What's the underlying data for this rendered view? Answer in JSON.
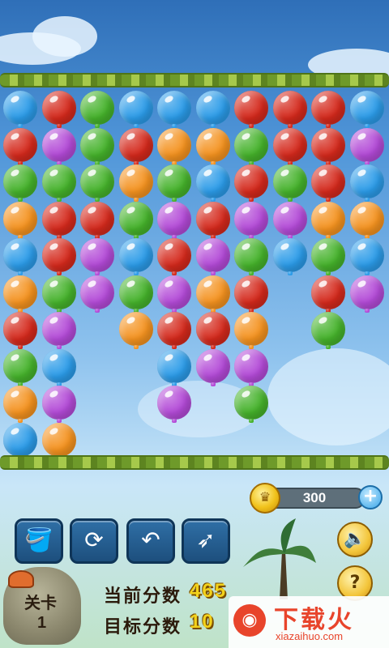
{
  "colors": {
    "blue": "#2b9be8",
    "red": "#d4291c",
    "green": "#45b22b",
    "orange": "#f4921f",
    "purple": "#b34ad7"
  },
  "board": {
    "rows": [
      [
        "blue",
        "red",
        "green",
        "blue",
        "blue",
        "blue",
        "red",
        "red",
        "red",
        "blue"
      ],
      [
        "red",
        "purple",
        "green",
        "red",
        "orange",
        "orange",
        "green",
        "red",
        "red",
        "purple"
      ],
      [
        "green",
        "green",
        "green",
        "orange",
        "green",
        "blue",
        "red",
        "green",
        "red",
        "blue"
      ],
      [
        "orange",
        "red",
        "red",
        "green",
        "purple",
        "red",
        "purple",
        "purple",
        "orange",
        "orange"
      ],
      [
        "blue",
        "red",
        "purple",
        "blue",
        "red",
        "purple",
        "green",
        "blue",
        "green",
        "blue"
      ],
      [
        "orange",
        "green",
        "purple",
        "green",
        "purple",
        "orange",
        "red",
        null,
        "red",
        "purple"
      ],
      [
        "red",
        "purple",
        null,
        "orange",
        "red",
        "red",
        "orange",
        null,
        "green",
        null
      ],
      [
        "green",
        "blue",
        null,
        null,
        "blue",
        "purple",
        "purple",
        null,
        null,
        null
      ],
      [
        "orange",
        "purple",
        null,
        null,
        "purple",
        null,
        "green",
        null,
        null,
        null
      ],
      [
        "blue",
        "orange",
        null,
        null,
        null,
        null,
        null,
        null,
        null,
        null
      ]
    ]
  },
  "hud": {
    "coins": "300",
    "plus_icon": "+",
    "score_label": "当前分数",
    "score_value": "465",
    "target_label": "目标分数",
    "target_value": "10",
    "level_label": "关卡",
    "level_value": "1"
  },
  "tools": [
    {
      "name": "paint-bucket-tool",
      "icon": "paint-bucket-icon",
      "glyph": "🪣"
    },
    {
      "name": "refresh-tool",
      "icon": "refresh-icon",
      "glyph": "⟳"
    },
    {
      "name": "undo-tool",
      "icon": "undo-icon",
      "glyph": "↶"
    },
    {
      "name": "dart-tool",
      "icon": "dart-icon",
      "glyph": "➶"
    }
  ],
  "buttons": {
    "sound_glyph": "🔈",
    "help_glyph": "?"
  },
  "watermark": {
    "logo_glyph": "◉",
    "title": "下载火",
    "site": "xiazaihuo.com"
  }
}
